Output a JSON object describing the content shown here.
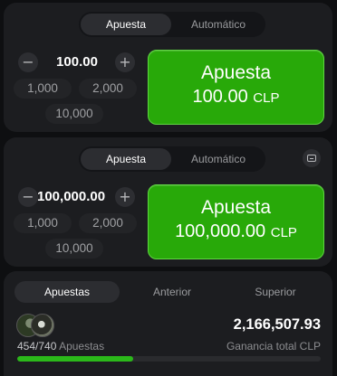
{
  "panel1": {
    "tabs": [
      "Apuesta",
      "Automático"
    ],
    "active_tab": 0,
    "amount": "100.00",
    "chips": [
      "1,000",
      "2,000",
      "10,000"
    ],
    "bet_button": {
      "line1": "Apuesta",
      "amount": "100.00",
      "currency": "CLP"
    }
  },
  "panel2": {
    "tabs": [
      "Apuesta",
      "Automático"
    ],
    "active_tab": 0,
    "amount": "100,000.00",
    "chips": [
      "1,000",
      "2,000",
      "10,000"
    ],
    "bet_button": {
      "line1": "Apuesta",
      "amount": "100,000.00",
      "currency": "CLP"
    }
  },
  "bets_panel": {
    "tabs": [
      "Apuestas",
      "Anterior",
      "Superior"
    ],
    "active_tab": 0,
    "bets_count": "454/740",
    "bets_label": "Apuestas",
    "total_win": "2,166,507.93",
    "total_win_label": "Ganancia total CLP",
    "progress_fraction": 0.3816
  },
  "icons": {
    "minus": "−",
    "plus": "+",
    "minimize": "minimize-icon"
  },
  "colors": {
    "bet_green": "#28a909",
    "progress_green": "#2bb81a",
    "panel_bg": "#1c1d20"
  }
}
